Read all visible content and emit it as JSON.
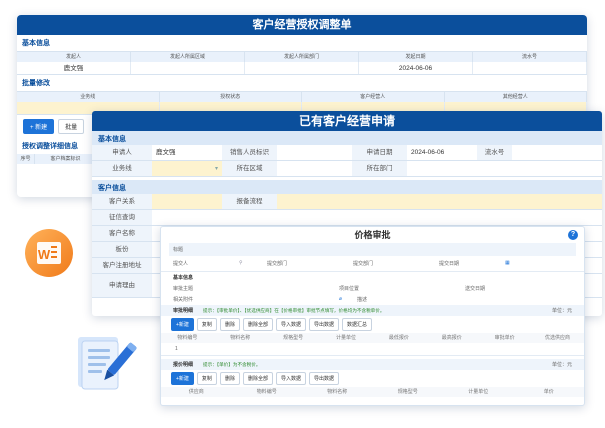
{
  "w1": {
    "title": "客户经营授权调整单",
    "sec_basic": "基本信息",
    "headers": [
      "发起人",
      "发起人所属区域",
      "发起人所属部门",
      "发起日期",
      "流水号"
    ],
    "values": [
      "鹿文强",
      "",
      "",
      "2024-06-06",
      ""
    ],
    "sec_batch": "批量修改",
    "batch_headers": [
      "业务线",
      "授权状态",
      "客户经营人",
      "其他经营人"
    ],
    "btn_new": "+ 新建",
    "btn_batch": "批量",
    "sec_detail": "授权调整详细信息",
    "detail_headers": [
      "序号",
      "客户档案标识"
    ]
  },
  "w2": {
    "title": "已有客户经营申请",
    "sec_basic": "基本信息",
    "row1": {
      "l1": "申请人",
      "v1": "鹿文强",
      "l2": "销售人员标识",
      "l3": "申请日期",
      "v3": "2024-06-06",
      "l4": "流水号"
    },
    "row2": {
      "l1": "业务线",
      "l2": "所在区域",
      "l3": "所在部门"
    },
    "sec_cust": "客户信息",
    "cust_labels": [
      "客户关系",
      "征信查询",
      "客户名称",
      "板份",
      "客户注册地址",
      "申请理由"
    ],
    "report_label": "报备流程"
  },
  "w3": {
    "title": "价格审批",
    "top_label": "标题",
    "f_initiator": "提交人",
    "f_dept": "提交部门",
    "f_dept2": "提交部门",
    "f_date": "提交日期",
    "sec_basic": "基本信息",
    "f_subject": "审批主题",
    "f_customer": "项目位置",
    "f_date2": "送交日期",
    "f_attach": "相关附件",
    "f_desc": "描述",
    "sec_approve": "审批明细",
    "note_approve": "提示：【审批单价】、【优选供应商】在【价格审批】审批节点填写，价格均为不含税单价。",
    "unit": "单位：元",
    "btns_approve": [
      "+新建",
      "复制",
      "删除",
      "删除全部",
      "导入数据",
      "导出数据",
      "数据汇总"
    ],
    "cols_approve": [
      "物料编号",
      "物料名称",
      "规格型号",
      "计量单位",
      "最低报价",
      "最高报价",
      "审批单价",
      "优选供应商"
    ],
    "row_no": "1",
    "sec_quote": "报价明细",
    "note_quote": "提示：【单价】为不含税价。",
    "btns_quote": [
      "+新建",
      "复制",
      "删除",
      "删除全部",
      "导入数据",
      "导出数据"
    ],
    "cols_quote": [
      "供应商",
      "物料编号",
      "物料名称",
      "规格型号",
      "计量单位",
      "单价"
    ]
  },
  "icons": {
    "word_letter": "W"
  },
  "colors": {
    "brand": "#0b4f9c",
    "accent": "#1d73d8",
    "highlight": "#fdf3cf"
  }
}
